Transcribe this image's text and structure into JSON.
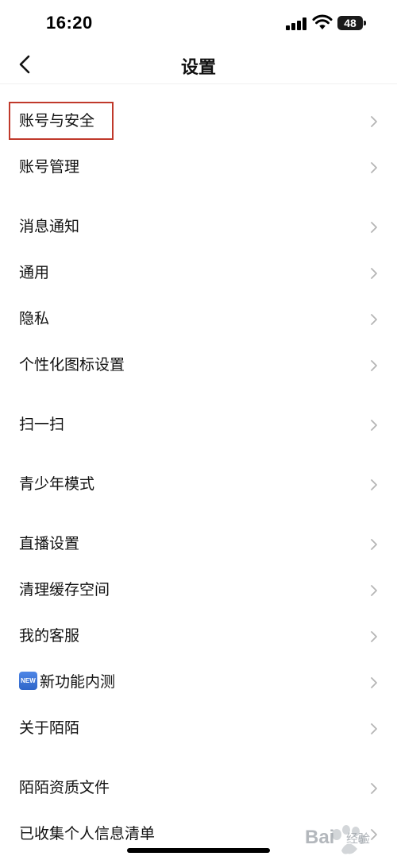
{
  "status_bar": {
    "time": "16:20",
    "battery": "48",
    "icons": [
      "signal-icon",
      "wifi-icon",
      "battery-icon"
    ]
  },
  "nav": {
    "title": "设置",
    "back_icon": "chevron-left-icon"
  },
  "settings": {
    "items": [
      {
        "label": "账号与安全",
        "highlighted": true
      },
      {
        "label": "账号管理"
      },
      {
        "label": "消息通知"
      },
      {
        "label": "通用"
      },
      {
        "label": "隐私"
      },
      {
        "label": "个性化图标设置"
      },
      {
        "label": "扫一扫"
      },
      {
        "label": "青少年模式"
      },
      {
        "label": "直播设置"
      },
      {
        "label": "清理缓存空间"
      },
      {
        "label": "我的客服"
      },
      {
        "label": "新功能内测",
        "badge": "NEW"
      },
      {
        "label": "关于陌陌"
      },
      {
        "label": "陌陌资质文件"
      },
      {
        "label": "已收集个人信息清单"
      }
    ]
  },
  "watermark": {
    "text": "Bai",
    "sub": "经验"
  },
  "colors": {
    "highlight_border": "#c0392b",
    "chevron": "#b5b5b5",
    "text": "#111111",
    "badge": "#3a72d8"
  }
}
